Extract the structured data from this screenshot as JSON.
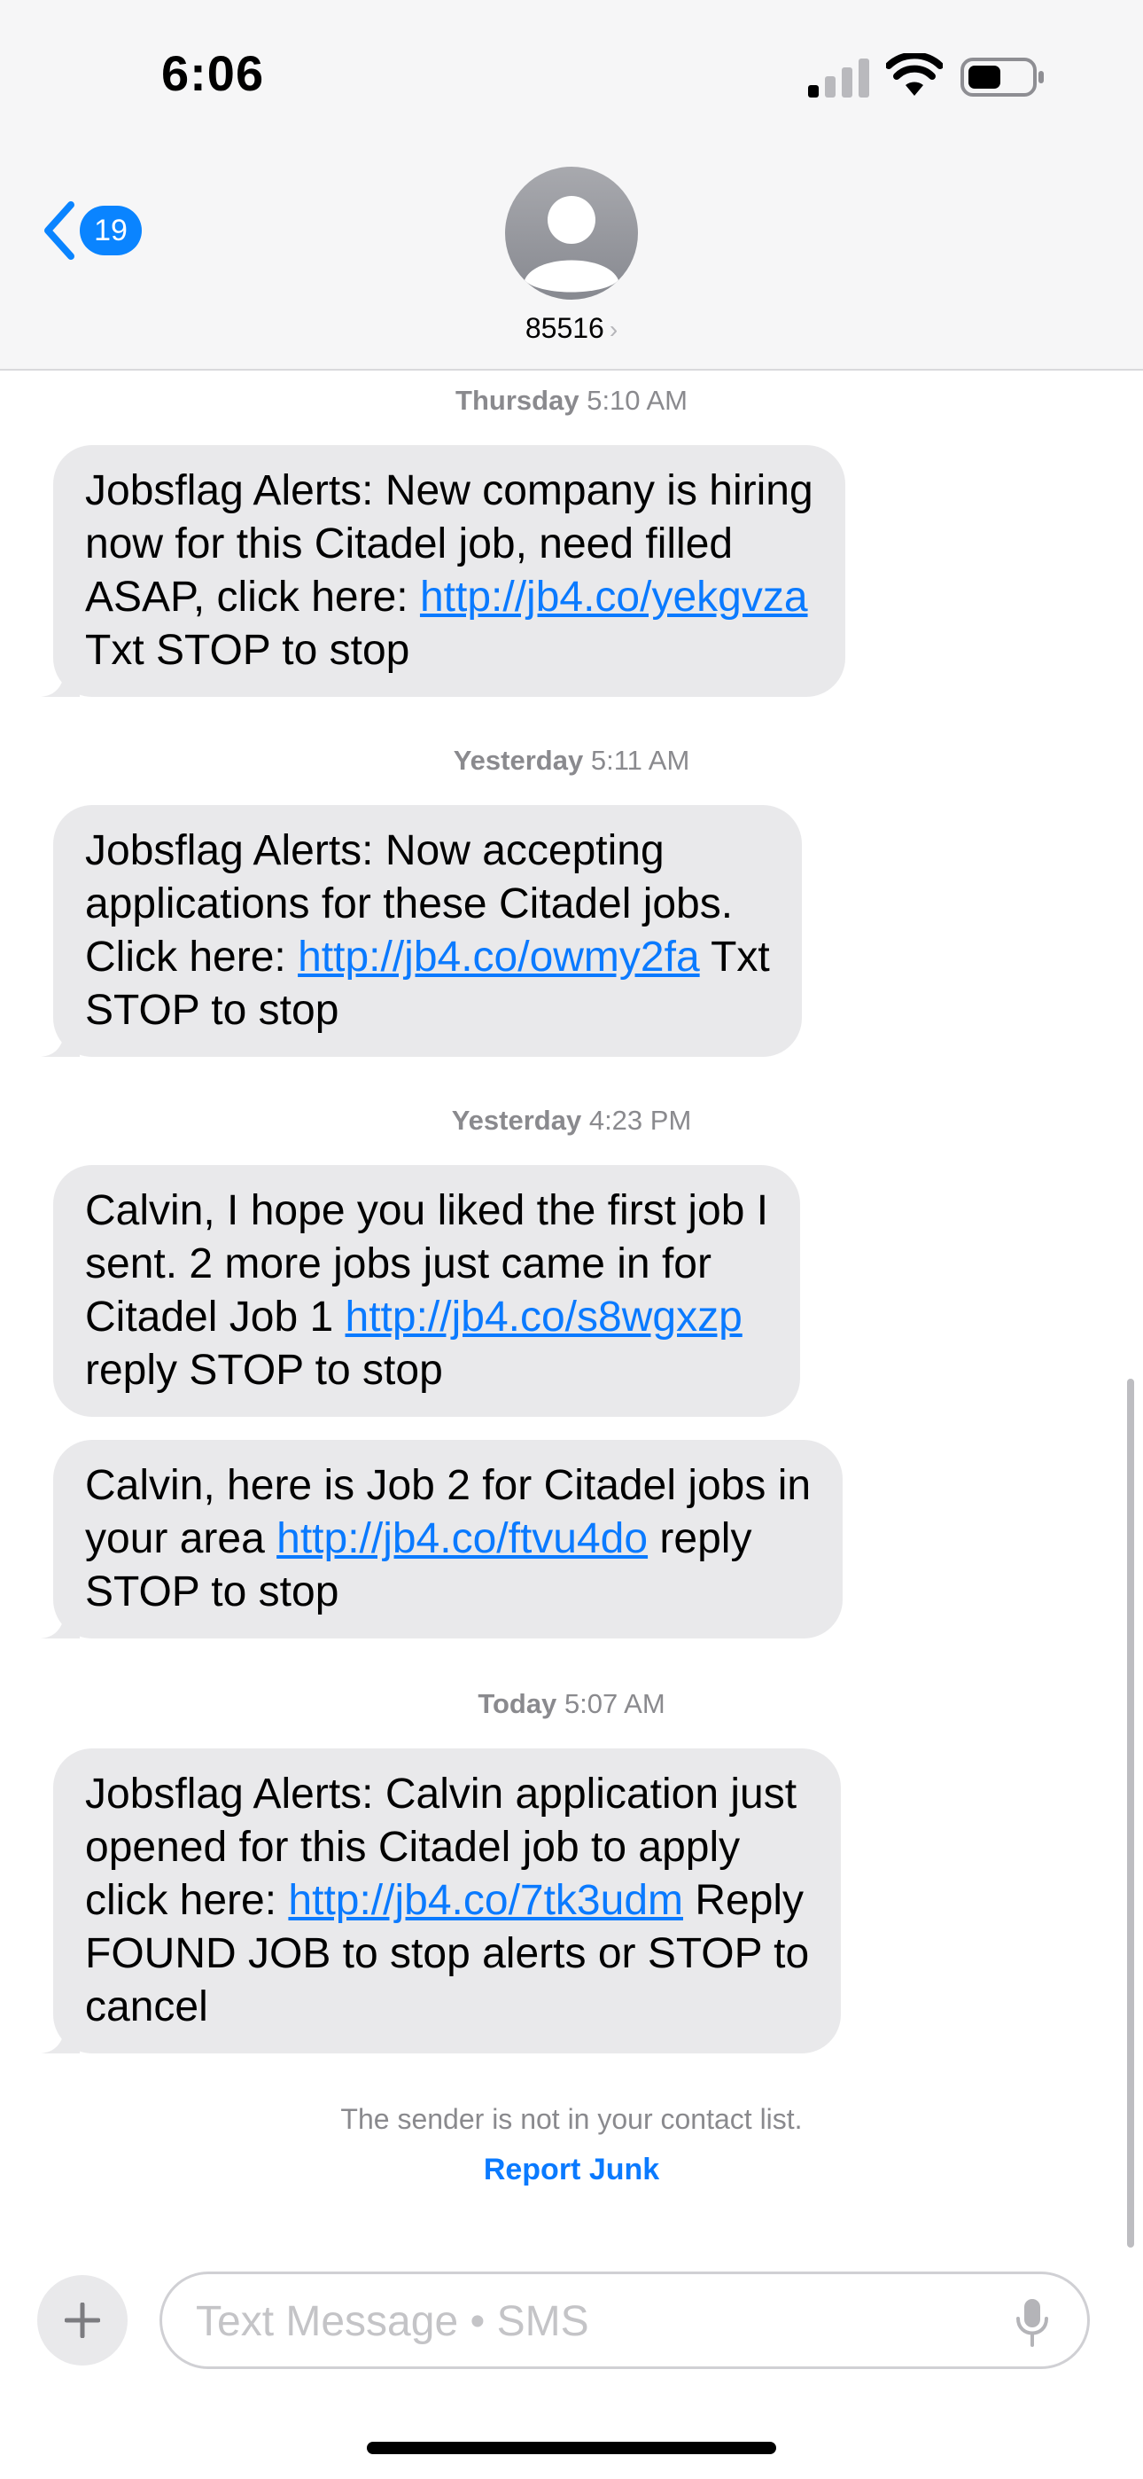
{
  "status_bar": {
    "time": "6:06"
  },
  "nav": {
    "back_badge": "19",
    "contact_name": "85516",
    "contact_chevron": "›"
  },
  "thread": {
    "groups": [
      {
        "timestamp_day": "Thursday",
        "timestamp_time": "5:10 AM",
        "messages": [
          {
            "before": "Jobsflag Alerts: New company is hiring\nnow for this Citadel job, need filled\nASAP, click here: ",
            "link": "http://jb4.co/yekgvza",
            "after": "\nTxt STOP to stop"
          }
        ]
      },
      {
        "timestamp_day": "Yesterday",
        "timestamp_time": "5:11 AM",
        "messages": [
          {
            "before": "Jobsflag Alerts: Now accepting\napplications for these Citadel jobs.\nClick here: ",
            "link": "http://jb4.co/owmy2fa",
            "after": " Txt\nSTOP to stop"
          }
        ]
      },
      {
        "timestamp_day": "Yesterday",
        "timestamp_time": "4:23 PM",
        "messages": [
          {
            "before": "Calvin, I hope you liked the first job I\nsent. 2 more jobs just came in for\nCitadel Job 1 ",
            "link": "http://jb4.co/s8wgxzp",
            "after": "\nreply STOP to stop"
          },
          {
            "before": "Calvin, here is Job 2 for Citadel jobs in\nyour area ",
            "link": "http://jb4.co/ftvu4do",
            "after": " reply\nSTOP to stop"
          }
        ]
      },
      {
        "timestamp_day": "Today",
        "timestamp_time": "5:07 AM",
        "messages": [
          {
            "before": "Jobsflag Alerts: Calvin application just\nopened for this Citadel job to apply\nclick here: ",
            "link": "http://jb4.co/7tk3udm",
            "after": " Reply\nFOUND JOB to stop alerts or STOP to\ncancel"
          }
        ]
      }
    ]
  },
  "footer": {
    "notice": "The sender is not in your contact list.",
    "report_label": "Report Junk"
  },
  "compose": {
    "placeholder": "Text Message • SMS",
    "value": ""
  },
  "colors": {
    "accent": "#0a84ff",
    "link": "#0a7aff",
    "bubble": "#e9e9eb",
    "header_bg": "#f6f6f7"
  },
  "icons": {
    "back": "chevron-left-icon",
    "avatar": "person-silhouette-icon",
    "plus": "plus-icon",
    "mic": "microphone-icon"
  }
}
